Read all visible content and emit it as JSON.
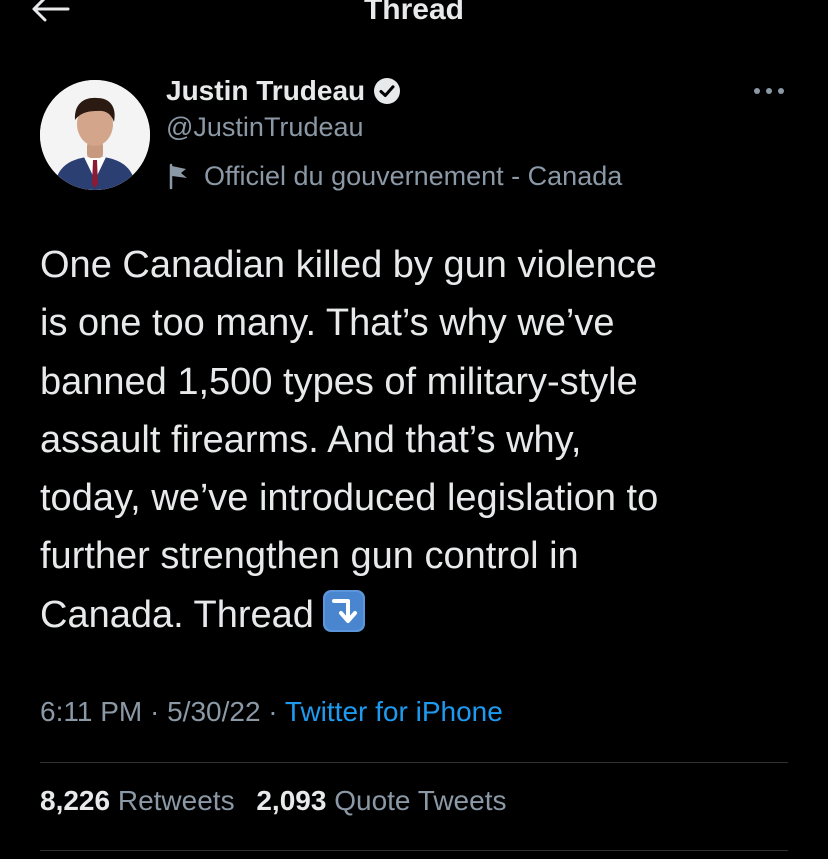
{
  "header": {
    "title": "Thread",
    "back_icon": "arrow-left-icon"
  },
  "tweet": {
    "author": {
      "name": "Justin Trudeau",
      "handle": "@JustinTrudeau",
      "verified": true,
      "gov_label": "Officiel du gouvernement - Canada"
    },
    "text_main": "One Canadian killed by gun violence\nis one too many. That’s why we’ve\nbanned 1,500 types of military-style\nassault firearms. And that’s why,\ntoday, we’ve introduced legislation to\nfurther strengthen gun control in\nCanada. Thread",
    "time": "6:11 PM",
    "sep1": " · ",
    "date": "5/30/22",
    "sep2": " · ",
    "source": "Twitter for iPhone",
    "retweets_count": "8,226",
    "retweets_label": "Retweets",
    "quotes_count": "2,093",
    "quotes_label": "Quote Tweets"
  },
  "colors": {
    "background": "#000000",
    "text_primary": "#e7e9ea",
    "text_secondary": "#8b98a5",
    "link": "#1d9bf0",
    "divider": "#2f3336"
  }
}
